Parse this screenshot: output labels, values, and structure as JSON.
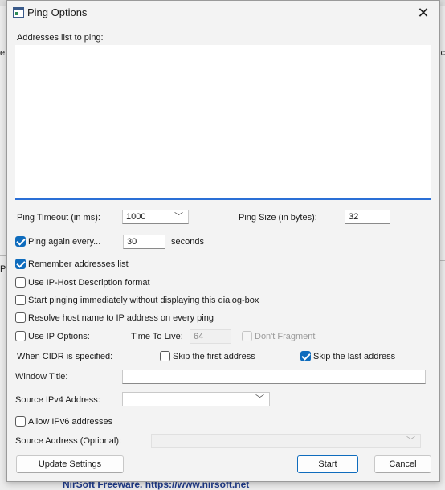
{
  "background": {
    "edge_left_text": "e",
    "edge_right_text": "c",
    "edge_left_lower_text": "P",
    "footer_text": "NirSoft Freeware. https://www.nirsoft.net"
  },
  "window": {
    "title": "Ping Options",
    "close_glyph": "✕"
  },
  "addresses": {
    "label": "Addresses list to ping:",
    "value": ""
  },
  "ping_timeout": {
    "label": "Ping Timeout (in ms):",
    "value": "1000"
  },
  "ping_size": {
    "label": "Ping Size (in bytes):",
    "value": "32"
  },
  "ping_again": {
    "label": "Ping again every...",
    "checked": true,
    "value": "30",
    "unit": "seconds"
  },
  "options": {
    "remember": {
      "label": "Remember addresses list",
      "checked": true
    },
    "ip_host_format": {
      "label": "Use IP-Host Description format",
      "checked": false
    },
    "start_immediately": {
      "label": "Start pinging immediately without displaying this dialog-box",
      "checked": false
    },
    "resolve_host": {
      "label": "Resolve host name to IP address on every ping",
      "checked": false
    },
    "use_ip_options": {
      "label": "Use IP Options:",
      "checked": false
    }
  },
  "ttl": {
    "label": "Time To Live:",
    "value": "64"
  },
  "dont_fragment": {
    "label": "Don't Fragment",
    "checked": false
  },
  "cidr": {
    "label": "When CIDR is specified:",
    "skip_first": {
      "label": "Skip the first address",
      "checked": false
    },
    "skip_last": {
      "label": "Skip the last address",
      "checked": true
    }
  },
  "window_title": {
    "label": "Window Title:",
    "value": ""
  },
  "source_ipv4": {
    "label": "Source IPv4 Address:",
    "value": ""
  },
  "allow_ipv6": {
    "label": "Allow IPv6 addresses",
    "checked": false
  },
  "source_address": {
    "label": "Source Address (Optional):",
    "value": ""
  },
  "buttons": {
    "update": "Update Settings",
    "start": "Start",
    "cancel": "Cancel"
  },
  "icons": {
    "dropdown": "chevron-down-icon",
    "close": "close-icon",
    "check": "checkmark-icon"
  }
}
